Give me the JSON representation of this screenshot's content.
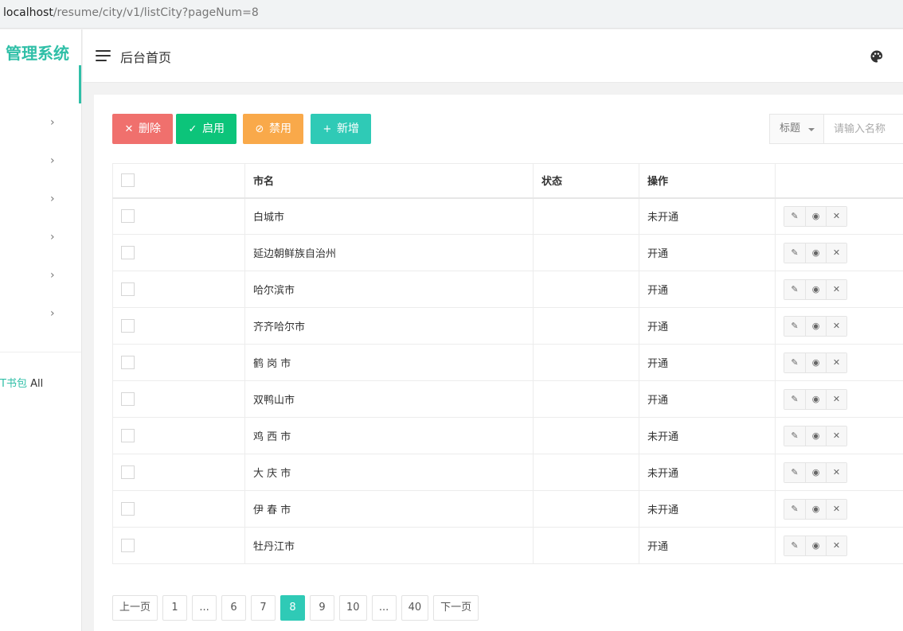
{
  "browser": {
    "url_host": "localhost",
    "url_path": "/resume/city/v1/listCity?pageNum=8"
  },
  "sidebar": {
    "brand": "管理系统",
    "chevron": "›",
    "footer_link": "T书包",
    "footer_text": " All",
    "accent_color": "#2fbfa7"
  },
  "header": {
    "title": "后台首页",
    "menu_icon": "hamburger-icon",
    "theme_icon": "palette-icon"
  },
  "toolbar": {
    "delete_label": "删除",
    "enable_label": "启用",
    "disable_label": "禁用",
    "add_label": "新增",
    "delete_icon": "✕",
    "enable_icon": "✓",
    "disable_icon": "⊘",
    "add_icon": "+"
  },
  "search": {
    "field_label": "标题",
    "placeholder": "请输入名称",
    "value": ""
  },
  "table": {
    "headers": {
      "name": "市名",
      "status": "状态",
      "ops": "操作",
      "actions": ""
    },
    "rows": [
      {
        "name": "白城市",
        "status": "",
        "ops": "未开通"
      },
      {
        "name": "延边朝鲜族自治州",
        "status": "",
        "ops": "开通"
      },
      {
        "name": "哈尔滨市",
        "status": "",
        "ops": "开通"
      },
      {
        "name": "齐齐哈尔市",
        "status": "",
        "ops": "开通"
      },
      {
        "name": "鹤 岗 市",
        "status": "",
        "ops": "开通"
      },
      {
        "name": "双鸭山市",
        "status": "",
        "ops": "开通"
      },
      {
        "name": "鸡 西 市",
        "status": "",
        "ops": "未开通"
      },
      {
        "name": "大 庆 市",
        "status": "",
        "ops": "未开通"
      },
      {
        "name": "伊 春 市",
        "status": "",
        "ops": "未开通"
      },
      {
        "name": "牡丹江市",
        "status": "",
        "ops": "开通"
      }
    ],
    "action_icons": {
      "edit": "✎",
      "view": "◉",
      "delete": "✕"
    }
  },
  "pagination": {
    "prev": "上一页",
    "next": "下一页",
    "items": [
      "1",
      "...",
      "6",
      "7",
      "8",
      "9",
      "10",
      "...",
      "40"
    ],
    "current": "8"
  },
  "colors": {
    "delete": "#f0706d",
    "enable": "#0cc47a",
    "disable": "#f9a94a",
    "add": "#2fcab6"
  }
}
